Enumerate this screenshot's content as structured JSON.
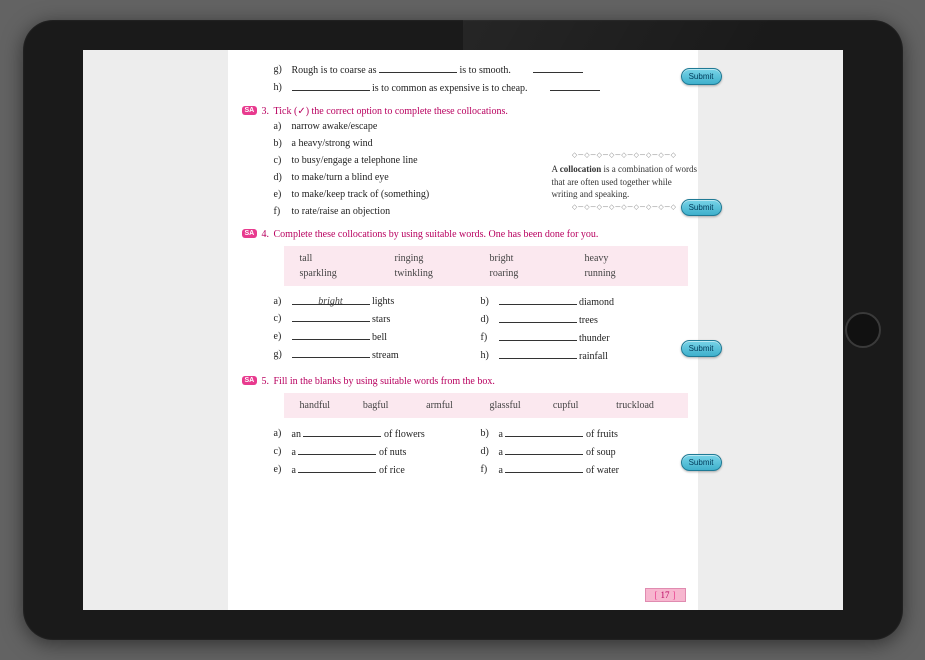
{
  "q2": {
    "g": {
      "label": "g)",
      "t1": "Rough is to coarse as",
      "t2": "is to smooth."
    },
    "h": {
      "label": "h)",
      "t2": "is to common as expensive is to cheap."
    },
    "submit": "Submit"
  },
  "q3": {
    "badge": "SA",
    "num": "3.",
    "heading_a": "Tick (",
    "heading_tick": "✓",
    "heading_b": ") the correct option to complete these collocations.",
    "items": [
      {
        "l": "a)",
        "t": "narrow awake/escape"
      },
      {
        "l": "b)",
        "t": "a heavy/strong  wind"
      },
      {
        "l": "c)",
        "t": "to busy/engage a telephone line"
      },
      {
        "l": "d)",
        "t": "to make/turn a blind eye"
      },
      {
        "l": "e)",
        "t": "to make/keep  track of (something)"
      },
      {
        "l": "f)",
        "t": "to rate/raise  an objection"
      }
    ],
    "callout_a": "A ",
    "callout_b": "collocation",
    "callout_c": " is a combination of words that are often used together while writing and speaking.",
    "submit": "Submit"
  },
  "q4": {
    "badge": "SA",
    "num": "4.",
    "heading": "Complete these collocations by using suitable words. One has been done for you.",
    "box_row1": [
      "tall",
      "ringing",
      "bright",
      "heavy"
    ],
    "box_row2": [
      "sparkling",
      "twinkling",
      "roaring",
      "running"
    ],
    "left": [
      {
        "l": "a)",
        "ans": "bright",
        "w": "lights"
      },
      {
        "l": "c)",
        "ans": "",
        "w": "stars"
      },
      {
        "l": "e)",
        "ans": "",
        "w": "bell"
      },
      {
        "l": "g)",
        "ans": "",
        "w": "stream"
      }
    ],
    "right": [
      {
        "l": "b)",
        "ans": "",
        "w": "diamond"
      },
      {
        "l": "d)",
        "ans": "",
        "w": "trees"
      },
      {
        "l": "f)",
        "ans": "",
        "w": "thunder"
      },
      {
        "l": "h)",
        "ans": "",
        "w": "rainfall"
      }
    ],
    "submit": "Submit"
  },
  "q5": {
    "badge": "SA",
    "num": "5.",
    "heading": "Fill in the blanks by using suitable words from the box.",
    "box": [
      "handful",
      "bagful",
      "armful",
      "glassful",
      "cupful",
      "truckload"
    ],
    "left": [
      {
        "l": "a)",
        "pre": "an",
        "w": "of flowers"
      },
      {
        "l": "c)",
        "pre": "a",
        "w": "of nuts"
      },
      {
        "l": "e)",
        "pre": "a",
        "w": "of rice"
      }
    ],
    "right": [
      {
        "l": "b)",
        "pre": "a",
        "w": "of fruits"
      },
      {
        "l": "d)",
        "pre": "a",
        "w": "of soup"
      },
      {
        "l": "f)",
        "pre": "a",
        "w": "of water"
      }
    ],
    "submit": "Submit"
  },
  "page_number": "17"
}
